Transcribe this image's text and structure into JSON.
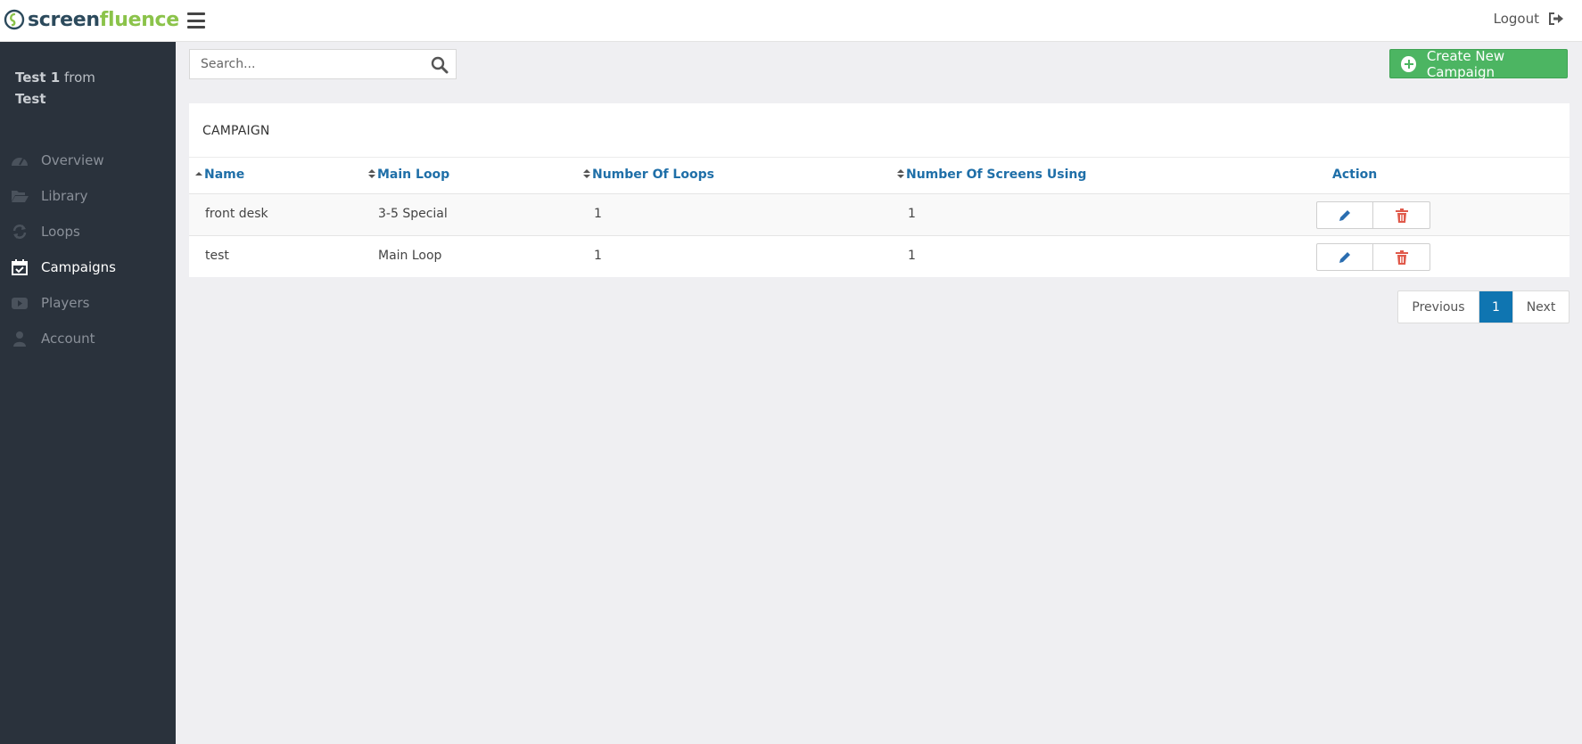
{
  "brand": {
    "part1": "screen",
    "part2": "fluence"
  },
  "header": {
    "logout_label": "Logout"
  },
  "user": {
    "name": "Test 1",
    "from_word": "from",
    "org": "Test"
  },
  "nav": [
    {
      "label": "Overview",
      "icon": "dashboard-icon"
    },
    {
      "label": "Library",
      "icon": "folder-open-icon"
    },
    {
      "label": "Loops",
      "icon": "refresh-icon"
    },
    {
      "label": "Campaigns",
      "icon": "calendar-check-icon",
      "active": true
    },
    {
      "label": "Players",
      "icon": "play-screen-icon"
    },
    {
      "label": "Account",
      "icon": "user-icon"
    }
  ],
  "search": {
    "placeholder": "Search..."
  },
  "create_button": {
    "label": "Create New Campaign"
  },
  "table": {
    "title": "CAMPAIGN",
    "columns": [
      "Name",
      "Main Loop",
      "Number Of Loops",
      "Number Of Screens Using",
      "Action"
    ],
    "rows": [
      {
        "name": "front desk",
        "main_loop": "3-5 Special",
        "loops": "1",
        "screens": "1"
      },
      {
        "name": "test",
        "main_loop": "Main Loop",
        "loops": "1",
        "screens": "1"
      }
    ]
  },
  "pagination": {
    "previous": "Previous",
    "current": "1",
    "next": "Next"
  },
  "colors": {
    "accent": "#1f6fa8",
    "create": "#4cb562",
    "sidebar": "#2a323c",
    "delete": "#e05a4b",
    "edit": "#2a6db0",
    "page_active": "#0f75b1"
  }
}
